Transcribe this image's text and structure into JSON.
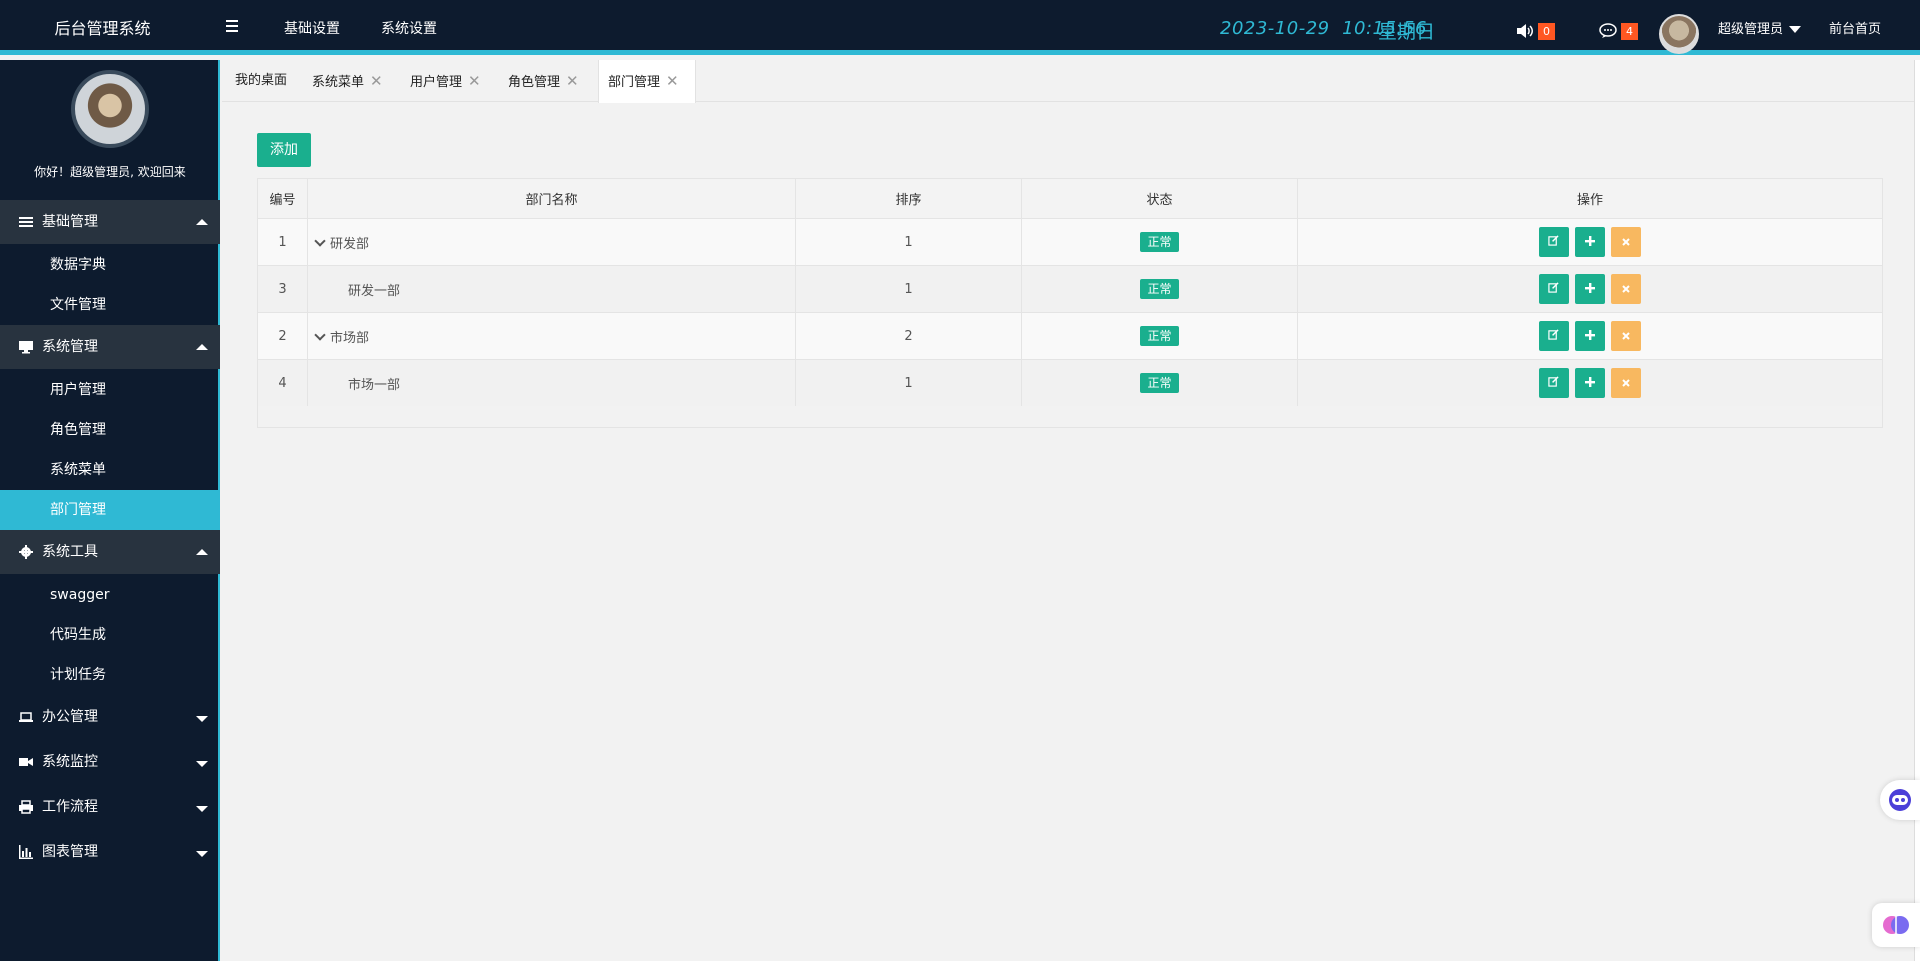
{
  "header": {
    "brand": "后台管理系统",
    "nav": [
      "基础设置",
      "系统设置"
    ],
    "date": "2023-10-29",
    "time": "10:15:56",
    "weekday": "星期日",
    "notice_count": "0",
    "message_count": "4",
    "user_name": "超级管理员",
    "front_link": "前台首页",
    "accent_color": "#2fb9d4"
  },
  "sidebar": {
    "greeting": "你好！超级管理员, 欢迎回来",
    "groups": [
      {
        "label": "基础管理",
        "icon": "list-icon",
        "items": [
          "数据字典",
          "文件管理"
        ]
      },
      {
        "label": "系统管理",
        "icon": "monitor-icon",
        "items": [
          "用户管理",
          "角色管理",
          "系统菜单",
          "部门管理"
        ]
      },
      {
        "label": "系统工具",
        "icon": "gear-icon",
        "items": [
          "swagger",
          "代码生成",
          "计划任务"
        ]
      },
      {
        "label": "办公管理",
        "icon": "laptop-icon"
      },
      {
        "label": "系统监控",
        "icon": "video-icon"
      },
      {
        "label": "工作流程",
        "icon": "printer-icon"
      },
      {
        "label": "图表管理",
        "icon": "bar-chart-icon"
      }
    ],
    "active_item": "部门管理"
  },
  "tabs": [
    "我的桌面",
    "系统菜单",
    "用户管理",
    "角色管理",
    "部门管理"
  ],
  "active_tab": "部门管理",
  "toolbar": {
    "add_label": "添加"
  },
  "table": {
    "columns": [
      "编号",
      "部门名称",
      "排序",
      "状态",
      "操作"
    ],
    "rows": [
      {
        "id": "1",
        "name": "研发部",
        "sort": "1",
        "status": "正常",
        "expandable": true
      },
      {
        "id": "3",
        "name": "研发一部",
        "sort": "1",
        "status": "正常",
        "expandable": false
      },
      {
        "id": "2",
        "name": "市场部",
        "sort": "2",
        "status": "正常",
        "expandable": true
      },
      {
        "id": "4",
        "name": "市场一部",
        "sort": "1",
        "status": "正常",
        "expandable": false
      }
    ]
  }
}
